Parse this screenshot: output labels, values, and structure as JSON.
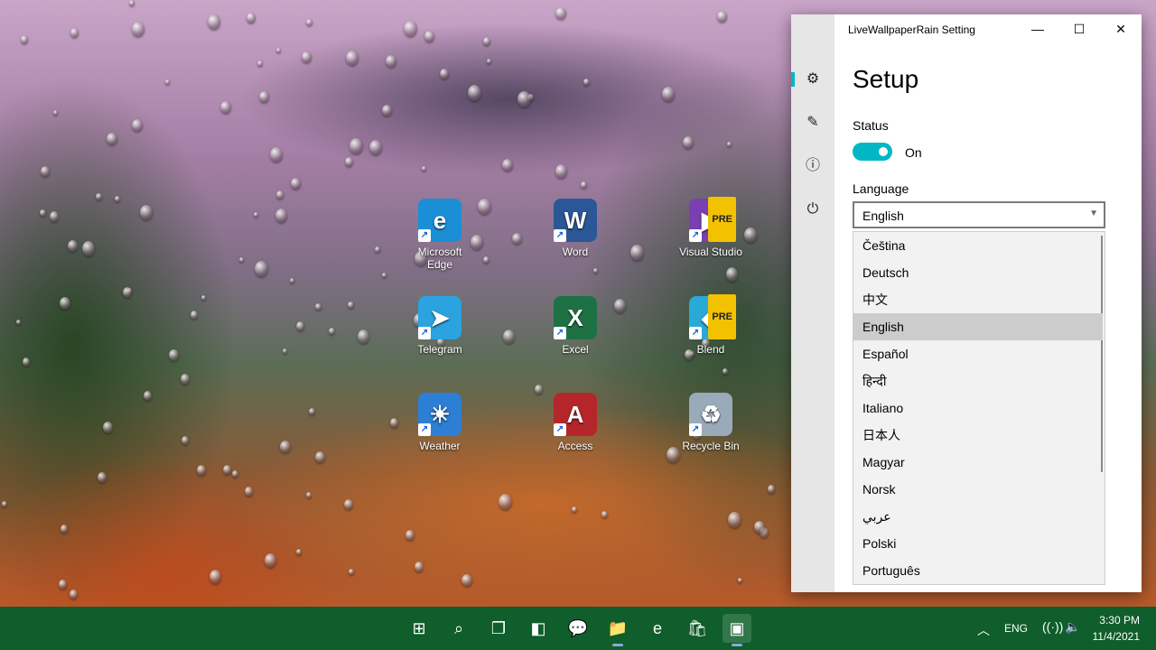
{
  "desktop": {
    "icons": [
      {
        "label": "Microsoft Edge",
        "icon": "edge-icon",
        "glyph": "e",
        "color": "#1a8fd6"
      },
      {
        "label": "Word",
        "icon": "word-icon",
        "glyph": "W",
        "color": "#2b5797"
      },
      {
        "label": "Visual Studio",
        "icon": "visual-studio-icon",
        "glyph": "▶",
        "color": "#7a3fb3",
        "badge": "PRE"
      },
      {
        "label": "Telegram",
        "icon": "telegram-icon",
        "glyph": "➤",
        "color": "#2aa3e0"
      },
      {
        "label": "Excel",
        "icon": "excel-icon",
        "glyph": "X",
        "color": "#1e7145"
      },
      {
        "label": "Blend",
        "icon": "blend-icon",
        "glyph": "◆",
        "color": "#29a9d8",
        "badge": "PRE"
      },
      {
        "label": "Weather",
        "icon": "weather-icon",
        "glyph": "☀",
        "color": "#2d7fd6"
      },
      {
        "label": "Access",
        "icon": "access-icon",
        "glyph": "A",
        "color": "#b5262a"
      },
      {
        "label": "Recycle Bin",
        "icon": "recycle-bin-icon",
        "glyph": "♻",
        "color": "#9ab"
      }
    ]
  },
  "window": {
    "title": "LiveWallpaperRain Setting",
    "controls": {
      "minimize": "—",
      "maximize": "☐",
      "close": "✕"
    },
    "nav": [
      {
        "icon": "settings-gear-icon",
        "glyph": "⚙"
      },
      {
        "icon": "edit-icon",
        "glyph": "✎"
      },
      {
        "icon": "info-icon",
        "glyph": "ⓘ"
      },
      {
        "icon": "power-icon",
        "glyph": "⏻"
      }
    ],
    "page_title": "Setup",
    "status": {
      "label": "Status",
      "toggle_text": "On",
      "enabled": true
    },
    "language": {
      "label": "Language",
      "selected": "English",
      "arrow": "▼",
      "options": [
        "Čeština",
        "Deutsch",
        "中文",
        "English",
        "Español",
        "हिन्दी",
        "Italiano",
        "日本人",
        "Magyar",
        "Norsk",
        "عربي",
        "Polski",
        "Português"
      ]
    }
  },
  "taskbar": {
    "apps": [
      {
        "icon": "start-icon",
        "glyph": "⊞"
      },
      {
        "icon": "search-icon",
        "glyph": "⌕"
      },
      {
        "icon": "task-view-icon",
        "glyph": "❐"
      },
      {
        "icon": "widgets-icon",
        "glyph": "◧"
      },
      {
        "icon": "teams-chat-icon",
        "glyph": "💬"
      },
      {
        "icon": "file-explorer-icon",
        "glyph": "📁"
      },
      {
        "icon": "edge-icon",
        "glyph": "e"
      },
      {
        "icon": "store-icon",
        "glyph": "🛍"
      },
      {
        "icon": "live-wallpaper-rain-icon",
        "glyph": "▣"
      }
    ],
    "tray": {
      "chevron": "︿",
      "language": "ENG",
      "wifi": "wifi-icon",
      "volume": "volume-icon",
      "time": "3:30 PM",
      "date": "11/4/2021"
    }
  },
  "colors": {
    "accent": "#00b7c3",
    "taskbar": "#0f5e2b",
    "selected_item": "#cccccc"
  }
}
